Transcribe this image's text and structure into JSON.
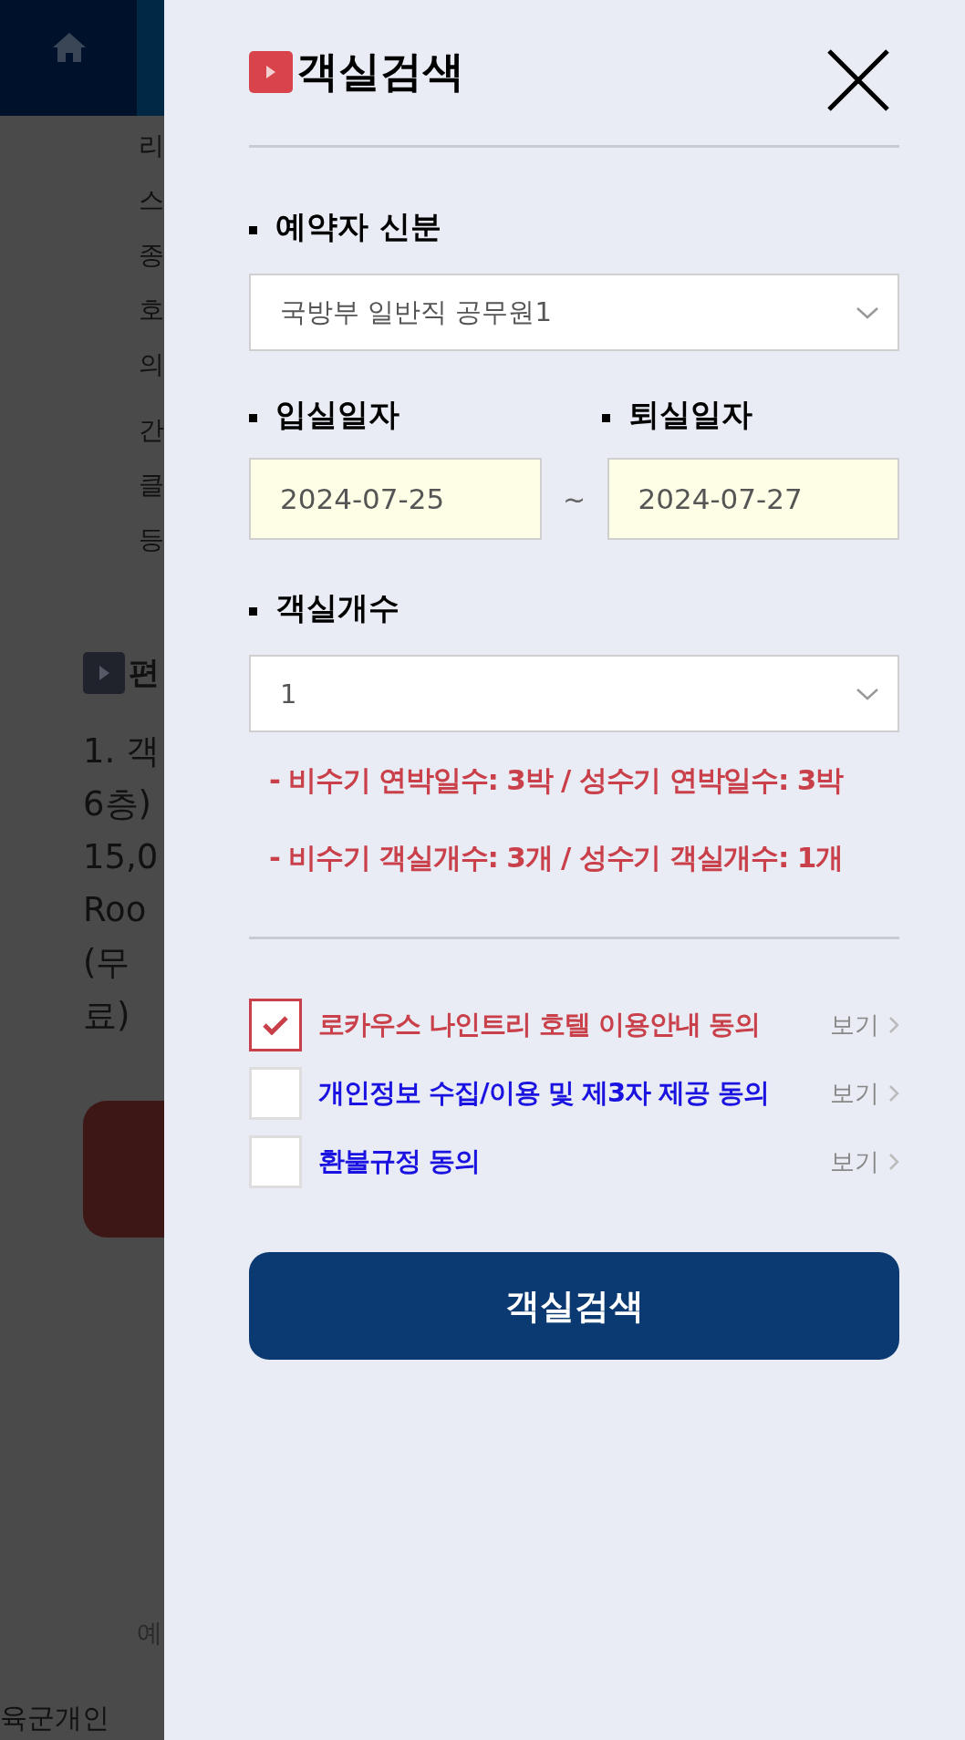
{
  "background_page": {
    "header": {
      "kind": "home"
    },
    "side_lines": [
      "리",
      "스",
      "종",
      "호",
      "의",
      "간",
      "클",
      "등"
    ],
    "section_heading": "편",
    "item_lines": [
      "1. 객",
      "6층)",
      "15,0",
      "Roo",
      "(무",
      "료)"
    ],
    "footnote": "예",
    "footer": "육군개인"
  },
  "panel": {
    "title": "객실검색",
    "guest_type": {
      "label": "예약자 신분",
      "value": "국방부 일반직 공무원1"
    },
    "check_in": {
      "label": "입실일자",
      "value": "2024-07-25"
    },
    "separator": "~",
    "check_out": {
      "label": "퇴실일자",
      "value": "2024-07-27"
    },
    "rooms": {
      "label": "객실개수",
      "value": "1"
    },
    "notes": [
      "- 비수기 연박일수: 3박 / 성수기 연박일수: 3박",
      "- 비수기 객실개수: 3개 / 성수기 객실개수: 1개"
    ],
    "agreements": [
      {
        "label": "로카우스 나인트리 호텔 이용안내 동의",
        "checked": true,
        "link": "보기"
      },
      {
        "label": "개인정보 수집/이용 및 제3자 제공 동의",
        "checked": false,
        "link": "보기"
      },
      {
        "label": "환불규정 동의",
        "checked": false,
        "link": "보기"
      }
    ],
    "submit": "객실검색"
  }
}
